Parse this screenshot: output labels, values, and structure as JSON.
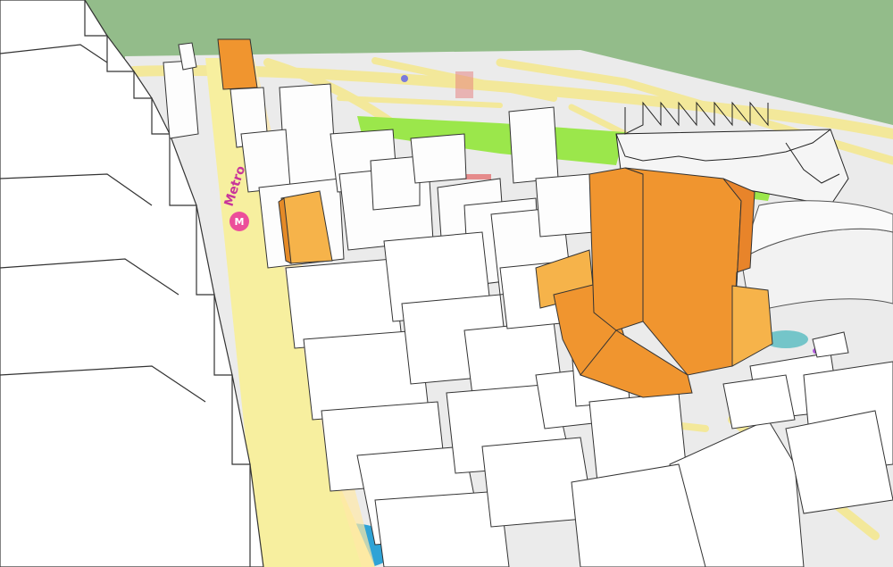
{
  "scene": {
    "colors": {
      "sky": "#93bc8a",
      "map_ground": "#ebebeb",
      "road": "#f3e89a",
      "main_avenue": "#f7ef9f",
      "park": "#9be74b",
      "highlight_building": "#f0952f",
      "highlight_shade": "#f6b34a",
      "building_face": "#ffffff",
      "building_outline": "#333333"
    },
    "map_labels": {
      "avenue_label": "Metro",
      "metro_badge": "M"
    },
    "features": [
      "street-map-ground",
      "white-3d-buildings",
      "orange-highlighted-buildings",
      "stadium",
      "park-strip"
    ]
  }
}
